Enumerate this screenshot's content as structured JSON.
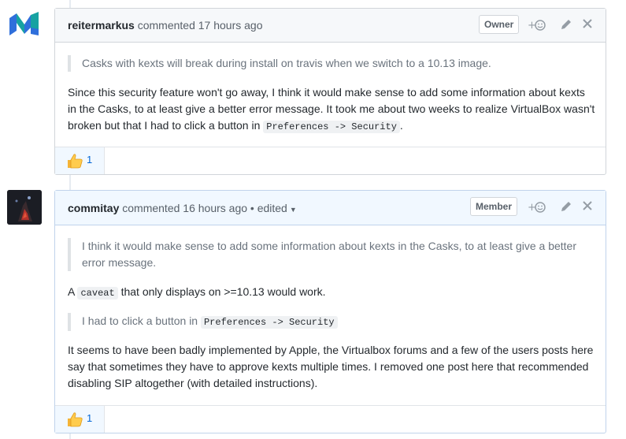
{
  "comments": [
    {
      "author": "reitermarkus",
      "meta": " commented 17 hours ago",
      "badge": "Owner",
      "quote": "Casks with kexts will break during install on travis when we switch to a 10.13 image.",
      "body_text": "Since this security feature won't go away, I think it would make sense to add some information about kexts in the Casks, to at least give a better error message. It took me about two weeks to realize VirtualBox wasn't broken but that I had to click a button in ",
      "body_code": "Preferences -> Security",
      "body_end": ".",
      "reaction": {
        "emoji": "thumbs-up",
        "count": "1"
      }
    },
    {
      "author": "commitay",
      "meta": " commented 16 hours ago • edited",
      "badge": "Member",
      "quote": "I think it would make sense to add some information about kexts in the Casks, to at least give a better error message.",
      "line2_pre": "A ",
      "line2_code": "caveat",
      "line2_post": " that only displays on >=10.13 would work.",
      "quote2_text": "I had to click a button in ",
      "quote2_code": "Preferences -> Security",
      "body_text": "It seems to have been badly implemented by Apple, the Virtualbox forums and a few of the users posts here say that sometimes they have to approve kexts multiple times. I removed one post here that recommended disabling SIP altogether (with detailed instructions).",
      "reaction": {
        "emoji": "thumbs-up",
        "count": "1"
      }
    }
  ],
  "colors": {
    "link": "#0366d6",
    "owner_head": "#f6f8fa",
    "member_head": "#f1f8ff",
    "logo_blue": "#2f6fdb",
    "logo_teal": "#17a2a2"
  }
}
